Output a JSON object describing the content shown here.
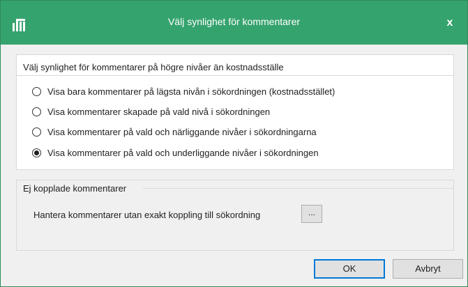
{
  "window": {
    "title": "Välj synlighet för kommentarer",
    "close_label": "x",
    "accent_color": "#35a36e"
  },
  "visibility_group": {
    "header": "Välj synlighet för kommentarer på högre nivåer än kostnadsställe",
    "options": [
      {
        "label": "Visa bara kommentarer på lägsta nivån i sökordningen (kostnadsstället)",
        "selected": false
      },
      {
        "label": "Visa kommentarer skapade på vald nivå i sökordningen",
        "selected": false
      },
      {
        "label": "Visa kommentarer på vald och närliggande nivåer i sökordningarna",
        "selected": false
      },
      {
        "label": "Visa kommentarer på vald och underliggande nivåer i sökordningen",
        "selected": true
      }
    ]
  },
  "unlinked_group": {
    "header": "Ej kopplade kommentarer",
    "manage_label": "Hantera kommentarer utan exakt koppling till sökordning",
    "browse_button": "..."
  },
  "buttons": {
    "ok": "OK",
    "cancel": "Avbryt"
  },
  "icons": {
    "app": "bar-chart-logo-icon"
  }
}
